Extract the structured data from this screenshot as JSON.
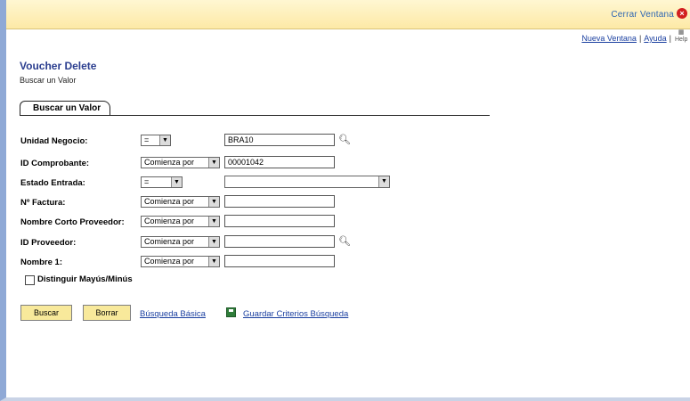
{
  "window": {
    "close_label": "Cerrar Ventana"
  },
  "toplinks": {
    "new_window": "Nueva Ventana",
    "help": "Ayuda",
    "separator": "|",
    "help_icon_text": "Help"
  },
  "page": {
    "title": "Voucher Delete",
    "subtitle": "Buscar un Valor"
  },
  "tab": {
    "label": "Buscar un Valor"
  },
  "fields": [
    {
      "label": "Unidad Negocio:",
      "operator": "=",
      "value": "BRA10"
    },
    {
      "label": "ID Comprobante:",
      "operator": "Comienza por",
      "value": "00001042"
    },
    {
      "label": "Estado Entrada:",
      "operator": "=",
      "value": ""
    },
    {
      "label": "Nº Factura:",
      "operator": "Comienza por",
      "value": ""
    },
    {
      "label": "Nombre Corto Proveedor:",
      "operator": "Comienza por",
      "value": ""
    },
    {
      "label": "ID Proveedor:",
      "operator": "Comienza por",
      "value": ""
    },
    {
      "label": "Nombre 1:",
      "operator": "Comienza por",
      "value": ""
    }
  ],
  "case_sensitive": {
    "label": "Distinguir Mayús/Minús",
    "checked": false
  },
  "buttons": {
    "search": "Buscar",
    "clear": "Borrar"
  },
  "links": {
    "basic_search": "Búsqueda Básica",
    "save_criteria": "Guardar Criterios Búsqueda"
  },
  "colors": {
    "title": "#2b3e8f",
    "link": "#1a3fa0",
    "button_bg": "#f8e99b",
    "top_bar": "#fde9a6"
  }
}
